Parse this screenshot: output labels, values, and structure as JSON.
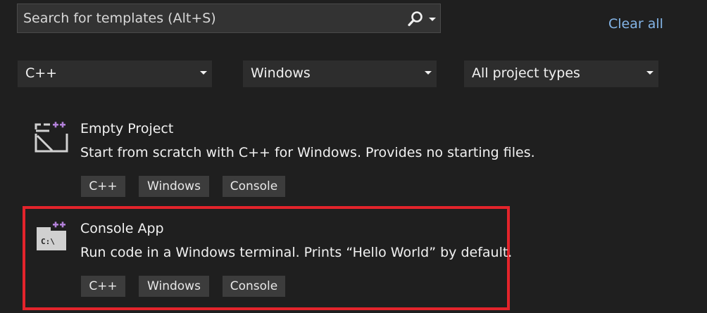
{
  "search": {
    "placeholder": "Search for templates (Alt+S)",
    "icon": "search-icon",
    "dropdown_icon": "chevron-down-icon"
  },
  "clear_all_label": "Clear all",
  "filters": [
    {
      "label": "C++"
    },
    {
      "label": "Windows"
    },
    {
      "label": "All project types"
    }
  ],
  "templates": [
    {
      "title": "Empty Project",
      "description": "Start from scratch with C++ for Windows. Provides no starting files.",
      "icon": "empty-project-icon",
      "tags": [
        "C++",
        "Windows",
        "Console"
      ],
      "selected": false
    },
    {
      "title": "Console App",
      "description": "Run code in a Windows terminal. Prints “Hello World” by default.",
      "icon": "console-app-icon",
      "icon_text": "C:\\",
      "tags": [
        "C++",
        "Windows",
        "Console"
      ],
      "selected": true
    }
  ],
  "colors": {
    "background": "#1f1f1f",
    "link": "#84b5e8",
    "selection_outline": "#e3242b",
    "cpp_badge": "#b180d7"
  }
}
